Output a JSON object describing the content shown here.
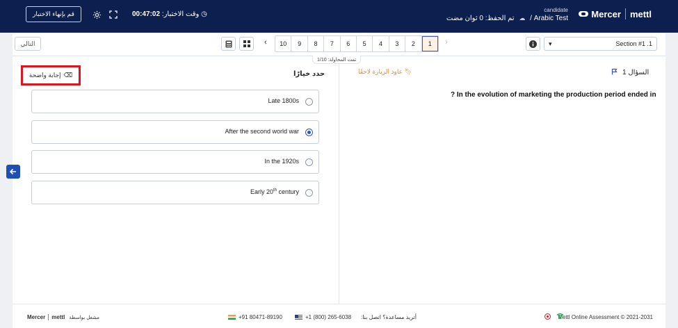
{
  "header": {
    "logo_mercer": "Mercer",
    "logo_mettl": "mettl",
    "candidate_role": "candidate",
    "test_name": "Arabic Test",
    "separator": "/",
    "saved_status": "تم الحفظ: 0 ثوان مضت",
    "timer_label": "وقت الاختبار:",
    "timer_value": "00:47:02",
    "finish_button": "قم بإنهاء الاختبار"
  },
  "nav": {
    "next_button": "التالي",
    "question_numbers": [
      "10",
      "9",
      "8",
      "7",
      "6",
      "5",
      "4",
      "3",
      "2",
      "1"
    ],
    "active_question": "1",
    "section_select": "Section #1 .1",
    "attempted": "تمت المحاولة: 1/10"
  },
  "question": {
    "heading": "السؤال 1",
    "review_later": "عاود الزيارة لاحقًا",
    "text": "? In the evolution of marketing the production period ended in"
  },
  "answers": {
    "choose_label": "حدد خيارًا",
    "clear_answer": "إجابة واضحة",
    "options": [
      {
        "text": "Late 1800s",
        "selected": false
      },
      {
        "text": "After the second world war",
        "selected": true
      },
      {
        "text": "In the 1920s",
        "selected": false
      },
      {
        "text_main": "Early 20",
        "text_sup": "th",
        "text_rest": " century",
        "selected": false
      }
    ]
  },
  "footer": {
    "copyright": "Mettl Online Assessment © 2021-2031",
    "help": "أتريد مساعدة؟ اتصل بنا:",
    "phone_us": "+1 (800) 265-6038",
    "phone_in": "+91 80471-89190",
    "powered_by": "مشغل بواسطة",
    "powered_mercer": "Mercer",
    "powered_mettl": "mettl"
  },
  "colors": {
    "header_bg": "#0d1f4f",
    "accent_blue": "#2f56c0",
    "review_orange": "#e58a2c",
    "highlight_red": "#e0141e"
  }
}
